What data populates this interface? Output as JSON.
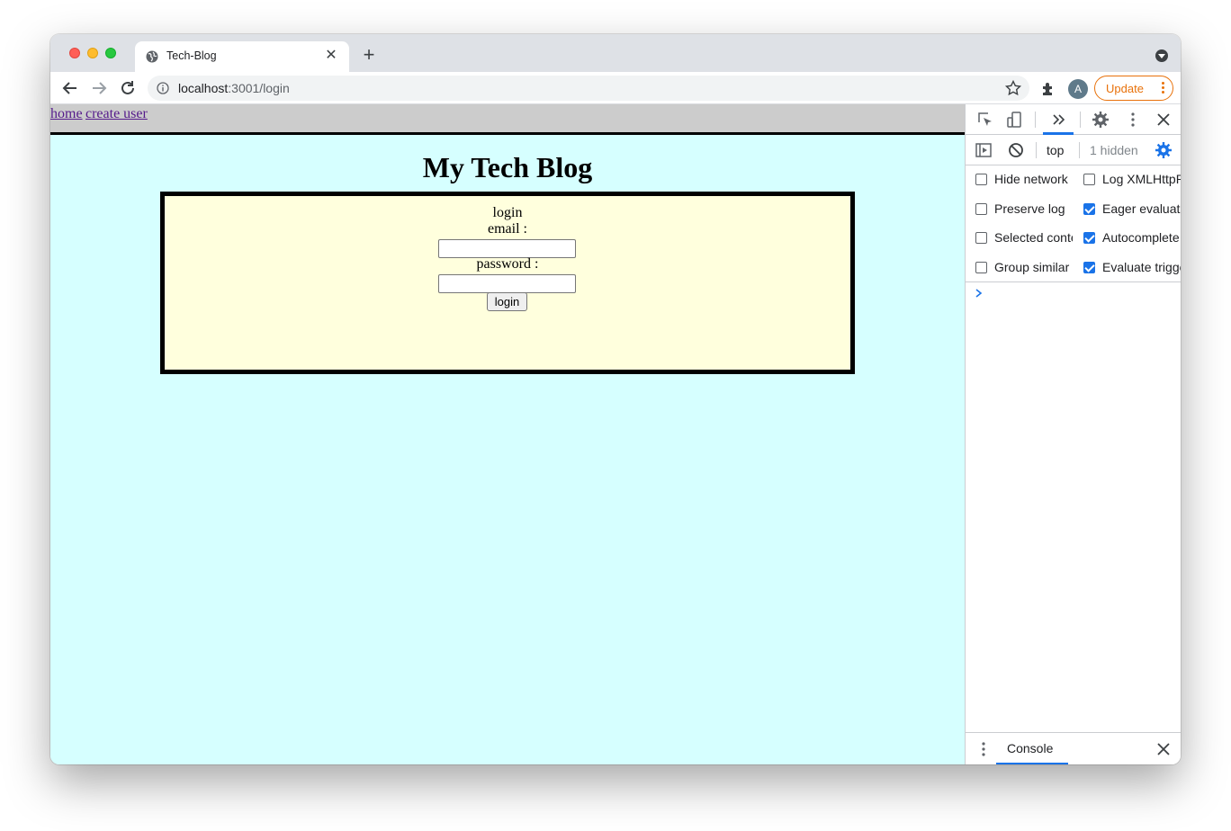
{
  "browser": {
    "tab_title": "Tech-Blog",
    "url_host": "localhost",
    "url_path": ":3001/login",
    "avatar_letter": "A",
    "update_label": "Update"
  },
  "page": {
    "nav": [
      {
        "label": "home"
      },
      {
        "label": "create user"
      }
    ],
    "title": "My Tech Blog",
    "login": {
      "heading": "login",
      "email_label": "email :",
      "email_value": "",
      "password_label": "password :",
      "password_value": "",
      "button_label": "login"
    },
    "colors": {
      "background": "#d6ffff",
      "login_box": "#ffffdd",
      "navbar": "#cccccc"
    }
  },
  "devtools": {
    "context": "top",
    "hidden_count": "1 hidden",
    "options": [
      {
        "label": "Hide network",
        "checked": false
      },
      {
        "label": "Log XMLHttpRequests",
        "checked": false
      },
      {
        "label": "Preserve log",
        "checked": false
      },
      {
        "label": "Eager evaluation",
        "checked": true
      },
      {
        "label": "Selected context only",
        "checked": false
      },
      {
        "label": "Autocomplete from history",
        "checked": true
      },
      {
        "label": "Group similar",
        "checked": false
      },
      {
        "label": "Evaluate triggers user activation",
        "checked": true
      }
    ],
    "drawer_tab": "Console"
  }
}
